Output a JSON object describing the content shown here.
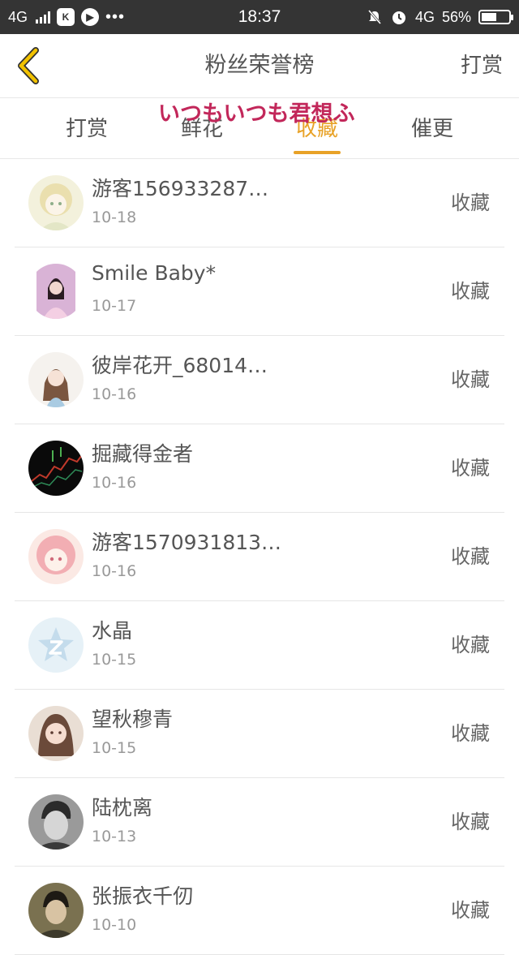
{
  "status_bar": {
    "network": "4G",
    "time": "18:37",
    "network_right": "4G",
    "battery_percent": "56%",
    "battery_level": 0.56
  },
  "header": {
    "title": "粉丝荣誉榜",
    "right_label": "打赏"
  },
  "tabs": [
    {
      "label": "打赏"
    },
    {
      "label": "鲜花"
    },
    {
      "label": "收藏"
    },
    {
      "label": "催更"
    }
  ],
  "active_tab": 2,
  "watermark": "いつもいつも君想ふ",
  "list": [
    {
      "name": "游客156933287…",
      "date": "10-18",
      "action": "收藏"
    },
    {
      "name": "Smile Baby*",
      "date": "10-17",
      "action": "收藏"
    },
    {
      "name": "彼岸花开_68014…",
      "date": "10-16",
      "action": "收藏"
    },
    {
      "name": "掘藏得金者",
      "date": "10-16",
      "action": "收藏"
    },
    {
      "name": "游客1570931813…",
      "date": "10-16",
      "action": "收藏"
    },
    {
      "name": "水晶",
      "date": "10-15",
      "action": "收藏"
    },
    {
      "name": "望秋穆青",
      "date": "10-15",
      "action": "收藏"
    },
    {
      "name": "陆枕离",
      "date": "10-13",
      "action": "收藏"
    },
    {
      "name": "张振衣千仞",
      "date": "10-10",
      "action": "收藏"
    }
  ],
  "colors": {
    "accent": "#e8a227",
    "status_bar_bg": "#343434",
    "watermark": "#c2275a"
  }
}
